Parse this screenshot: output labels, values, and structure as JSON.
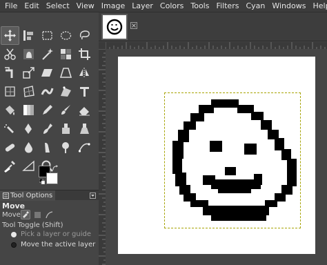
{
  "menubar": {
    "items": [
      "File",
      "Edit",
      "Select",
      "View",
      "Image",
      "Layer",
      "Colors",
      "Tools",
      "Filters",
      "Cyan",
      "Windows",
      "Help"
    ]
  },
  "toolbox": {
    "tools": [
      {
        "name": "move-tool",
        "icon": "move-icon",
        "active": true
      },
      {
        "name": "align-tool",
        "icon": "align-icon"
      },
      {
        "name": "rect-select-tool",
        "icon": "rect-select-icon"
      },
      {
        "name": "ellipse-select-tool",
        "icon": "ellipse-select-icon"
      },
      {
        "name": "free-select-tool",
        "icon": "lasso-icon"
      },
      {
        "name": "scissors-select-tool",
        "icon": "scissors-icon"
      },
      {
        "name": "foreground-select-tool",
        "icon": "foreground-select-icon"
      },
      {
        "name": "fuzzy-select-tool",
        "icon": "magic-wand-icon"
      },
      {
        "name": "select-by-color-tool",
        "icon": "select-by-color-icon"
      },
      {
        "name": "crop-tool",
        "icon": "crop-icon"
      },
      {
        "name": "rotate-tool",
        "icon": "rotate-icon"
      },
      {
        "name": "scale-tool",
        "icon": "scale-icon"
      },
      {
        "name": "shear-tool",
        "icon": "shear-icon"
      },
      {
        "name": "perspective-tool",
        "icon": "perspective-icon"
      },
      {
        "name": "flip-tool",
        "icon": "flip-icon"
      },
      {
        "name": "cage-tool",
        "icon": "cage-icon"
      },
      {
        "name": "unified-transform-tool",
        "icon": "unified-transform-icon"
      },
      {
        "name": "warp-transform-tool",
        "icon": "warp-icon"
      },
      {
        "name": "handle-transform-tool",
        "icon": "handle-transform-icon"
      },
      {
        "name": "text-tool",
        "icon": "text-icon"
      },
      {
        "name": "bucket-fill-tool",
        "icon": "bucket-icon"
      },
      {
        "name": "gradient-tool",
        "icon": "gradient-icon"
      },
      {
        "name": "pencil-tool",
        "icon": "pencil-icon"
      },
      {
        "name": "paintbrush-tool",
        "icon": "paintbrush-icon"
      },
      {
        "name": "eraser-tool",
        "icon": "eraser-icon"
      },
      {
        "name": "airbrush-tool",
        "icon": "airbrush-icon"
      },
      {
        "name": "ink-tool",
        "icon": "ink-icon"
      },
      {
        "name": "mypaint-brush-tool",
        "icon": "mypaint-brush-icon"
      },
      {
        "name": "clone-tool",
        "icon": "clone-icon"
      },
      {
        "name": "perspective-clone-tool",
        "icon": "perspective-clone-icon"
      },
      {
        "name": "heal-tool",
        "icon": "heal-icon"
      },
      {
        "name": "blur-tool",
        "icon": "blur-icon"
      },
      {
        "name": "smudge-tool",
        "icon": "smudge-icon"
      },
      {
        "name": "dodge-burn-tool",
        "icon": "dodge-burn-icon"
      },
      {
        "name": "paths-tool",
        "icon": "paths-icon"
      },
      {
        "name": "color-picker-tool",
        "icon": "color-picker-icon"
      },
      {
        "name": "measure-tool",
        "icon": "measure-icon"
      },
      {
        "name": "zoom-tool",
        "icon": "zoom-icon"
      }
    ],
    "fg_color": "#000000",
    "bg_color": "#ffffff"
  },
  "tool_options": {
    "tab_label": "Tool Options",
    "title": "Move",
    "move_label": "Move:",
    "toggle_label": "Tool Toggle  (Shift)",
    "options": [
      {
        "label": "Pick a layer or guide",
        "checked": true
      },
      {
        "label": "Move the active layer",
        "checked": false
      }
    ]
  },
  "colors": {
    "accent": "#a6a300",
    "panel": "#454545"
  }
}
